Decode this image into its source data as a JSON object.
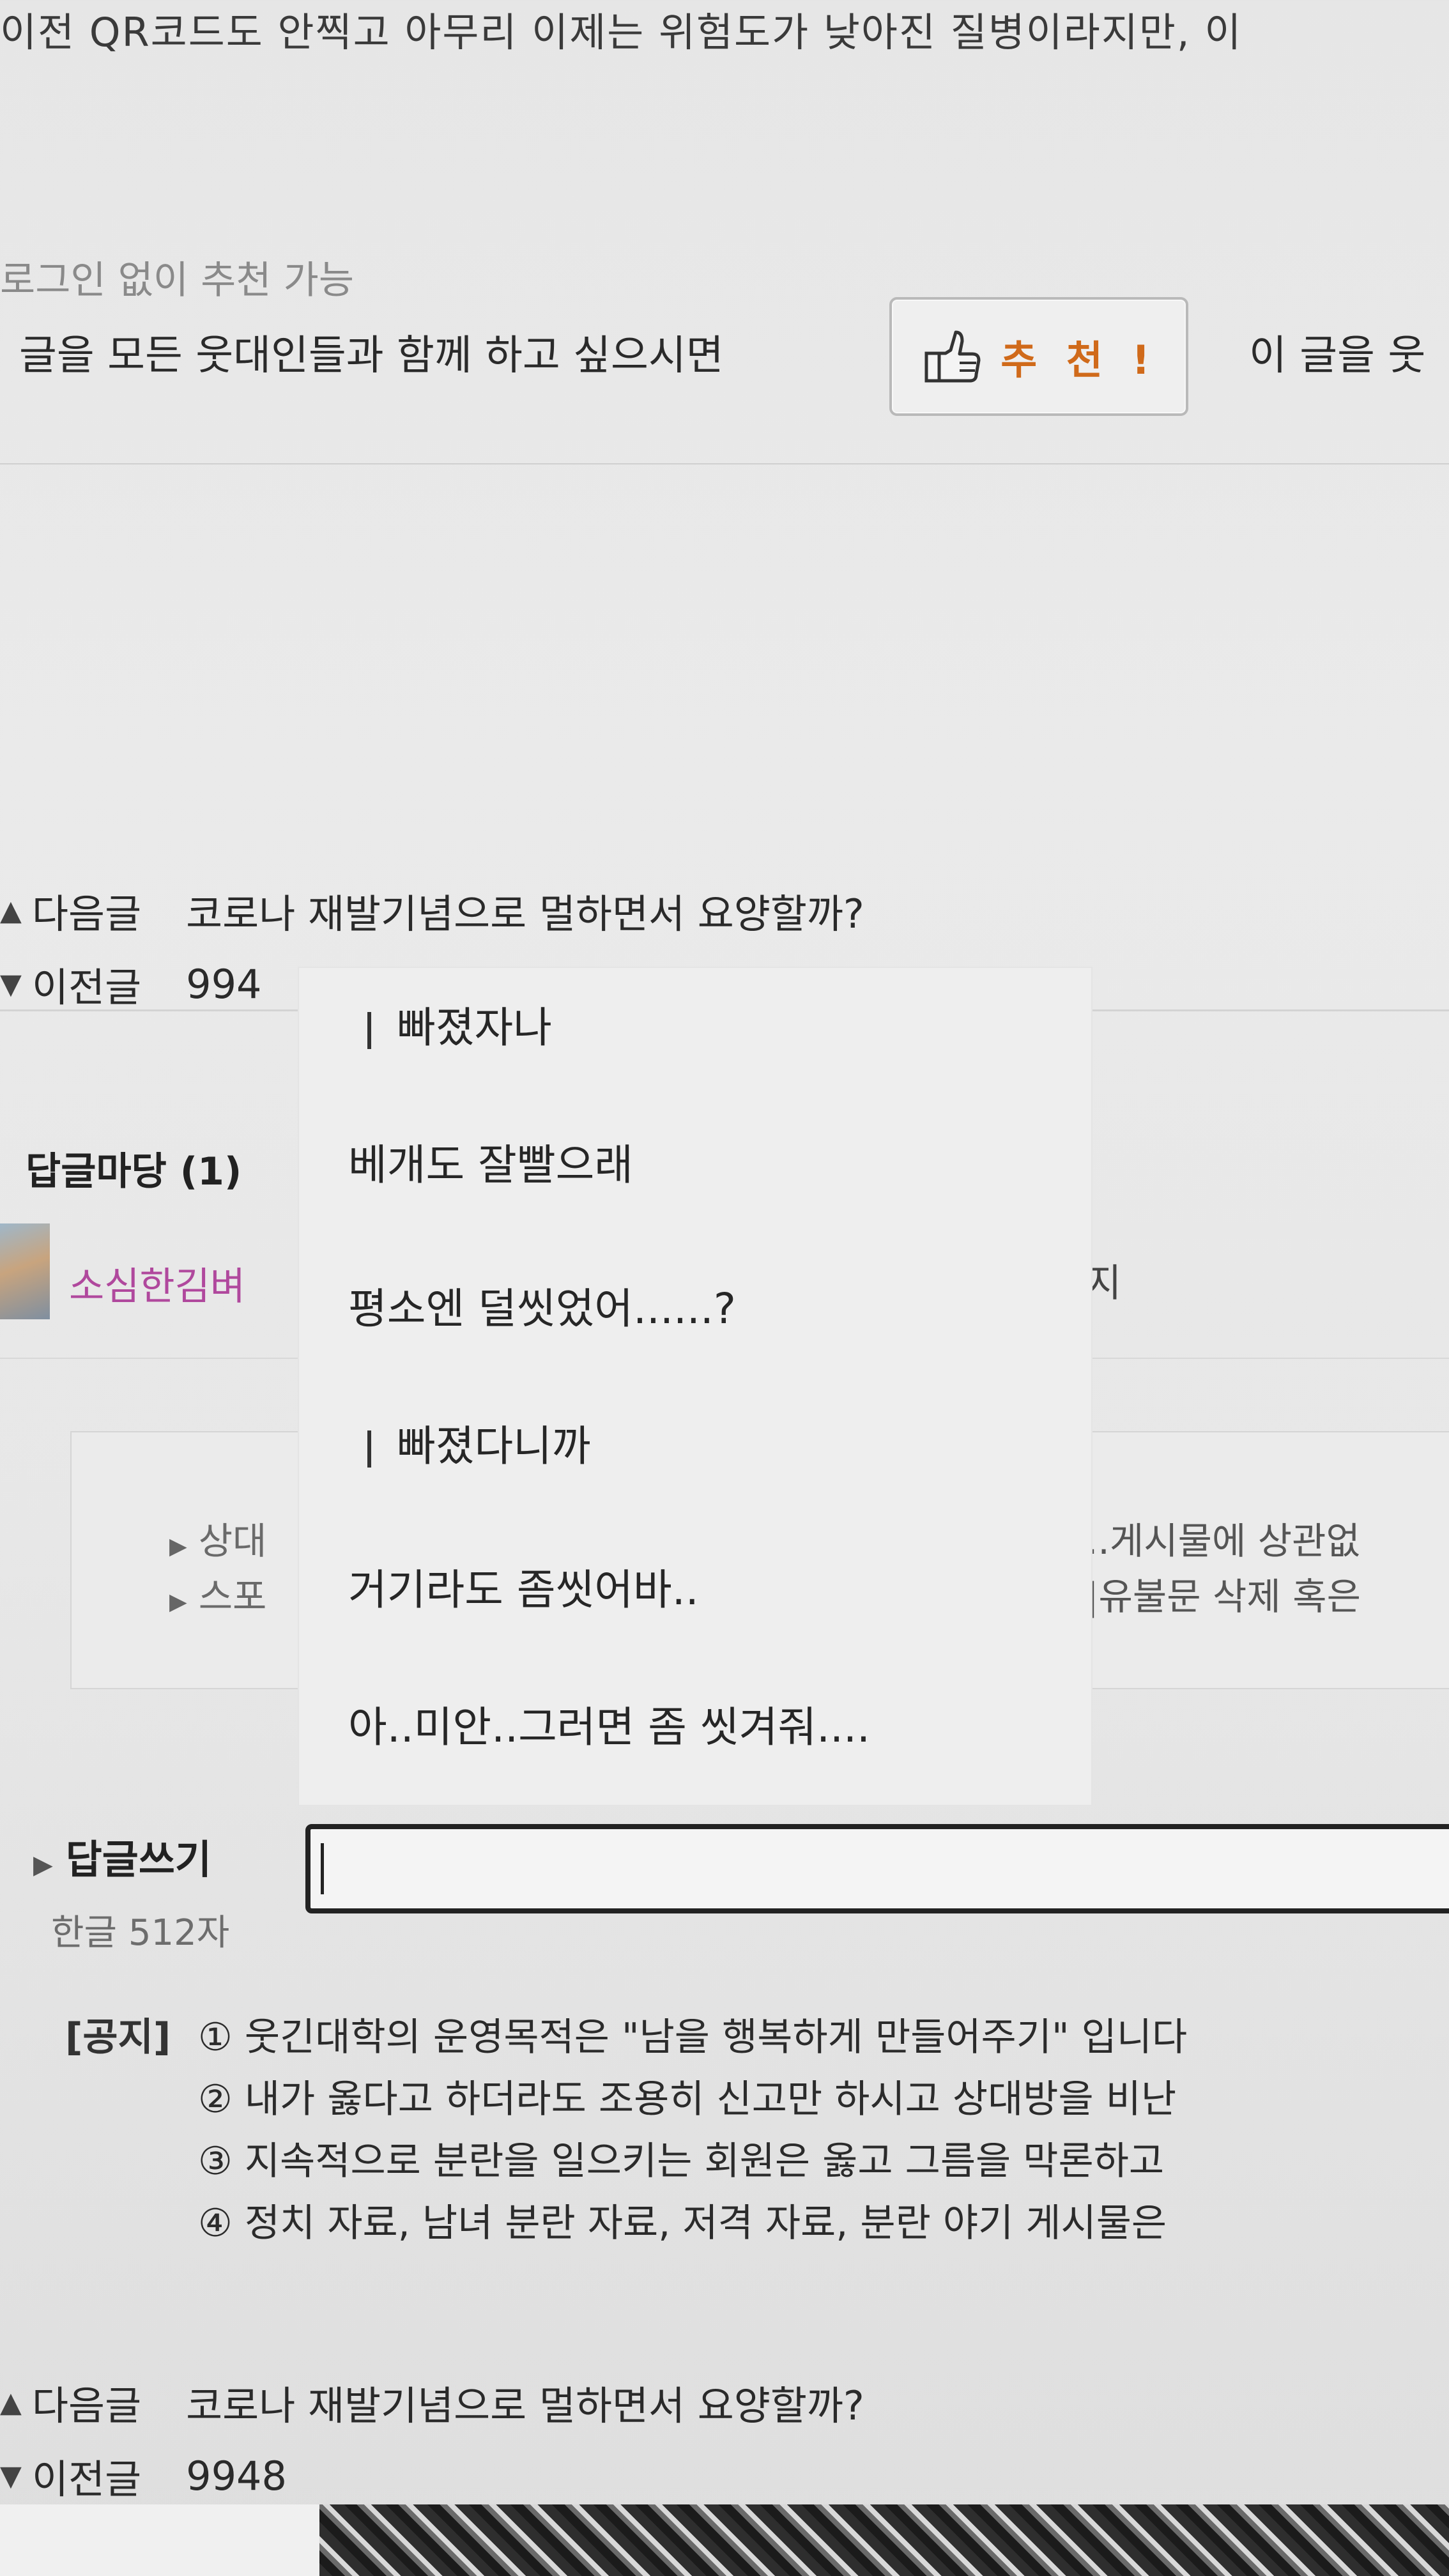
{
  "article": {
    "top_line": "이전 QR코드도 안찍고 아무리 이제는 위험도가 낮아진 질병이라지만, 이",
    "login_note": "로그인 없이 추천 가능",
    "recommend_prompt": "글을 모든 웃대인들과 함께 하고 싶으시면",
    "recommend_button": "추 천 !",
    "recommend_right": "이 글을 웃"
  },
  "nav_top": {
    "next_label": "다음글",
    "next_title": "코로나 재발기념으로 멀하면서 요양할까?",
    "prev_label": "이전글",
    "prev_title": "994"
  },
  "comments": {
    "title": "답글마당 (1)",
    "user": "소심한김벼",
    "right_fragment": "지",
    "rules": [
      {
        "left": "상대",
        "right": "..게시물에 상관없"
      },
      {
        "left": "스포",
        "right": "|유불문 삭제 혹은"
      }
    ]
  },
  "popup": {
    "lines": [
      {
        "text": "빠졌자나",
        "bar": true
      },
      {
        "text": "베개도 잘빨으래",
        "bar": false
      },
      {
        "text": "평소엔 덜씻었어......?",
        "bar": false
      },
      {
        "text": "빠졌다니까",
        "bar": true
      },
      {
        "text": "거기라도 좀씻어바..",
        "bar": false
      },
      {
        "text": "아..미안..그러면 좀 씻겨줘....",
        "bar": false
      }
    ]
  },
  "reply": {
    "label": "답글쓰기",
    "limit": "한글 512자"
  },
  "notices": {
    "tag": "[공지]",
    "items": [
      "① 웃긴대학의 운영목적은 \"남을 행복하게 만들어주기\" 입니다",
      "② 내가 옳다고 하더라도 조용히 신고만 하시고 상대방을 비난",
      "③ 지속적으로 분란을 일으키는 회원은 옳고 그름을 막론하고",
      "④ 정치 자료, 남녀 분란 자료, 저격 자료, 분란 야기 게시물은"
    ]
  },
  "nav_bottom": {
    "next_label": "다음글",
    "next_title": "코로나 재발기념으로 멀하면서 요양할까?",
    "prev_label": "이전글",
    "prev_title": "9948"
  },
  "colors": {
    "recommend_accent": "#d06a1a",
    "username": "#b0489d"
  }
}
